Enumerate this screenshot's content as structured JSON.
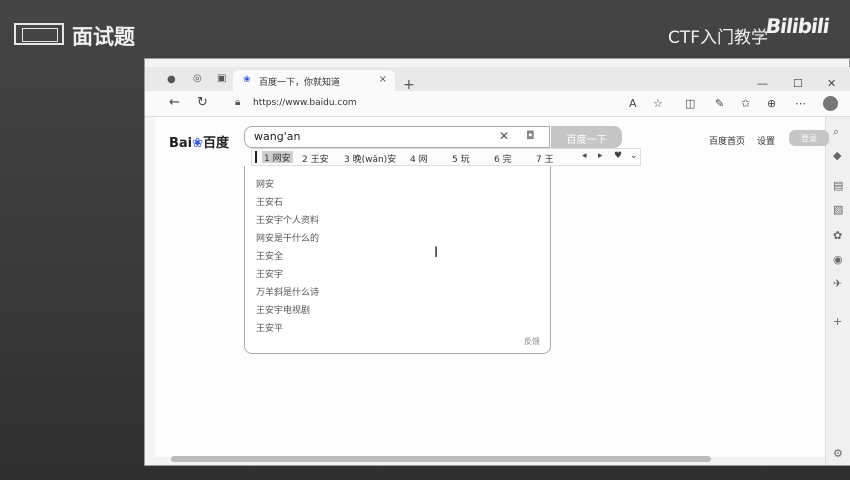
{
  "slide": {
    "title": "面试题",
    "brand": "CTF入门教学",
    "brand_logo": "Bilibili"
  },
  "browser": {
    "tab": {
      "title": "百度一下，你就知道",
      "favicon": "paw-icon",
      "close": "×"
    },
    "new_tab": "+",
    "window_controls": {
      "minimize": "—",
      "maximize": "☐",
      "close": "✕"
    },
    "nav": {
      "back": "←",
      "refresh": "↻"
    },
    "url": "https://www.baidu.com"
  },
  "baidu": {
    "logo_text_left": "Bai",
    "logo_paw": "🐾",
    "logo_text_right": "百度",
    "search_value": "wang'an",
    "search_button": "百度一下",
    "links": [
      "百度首页",
      "设置"
    ],
    "more_button": "登录"
  },
  "ime": {
    "candidates": [
      "1 网安",
      "2 王安",
      "3 晚(wǎn)安",
      "4 网",
      "5 玩",
      "6 完",
      "7 王"
    ]
  },
  "suggestions": {
    "items": [
      "网安",
      "王安石",
      "王安宇个人资料",
      "网安是干什么的",
      "王安全",
      "王安宇",
      "万羊斜是什么诗",
      "王安宇电视剧",
      "王安平"
    ],
    "feedback": "反馈"
  },
  "colors": {
    "slide_bg": "#3a3a3a",
    "browser_bg": "#f4f4f4",
    "search_button": "#c6c6c6",
    "baidu_blue": "#3355cc"
  }
}
